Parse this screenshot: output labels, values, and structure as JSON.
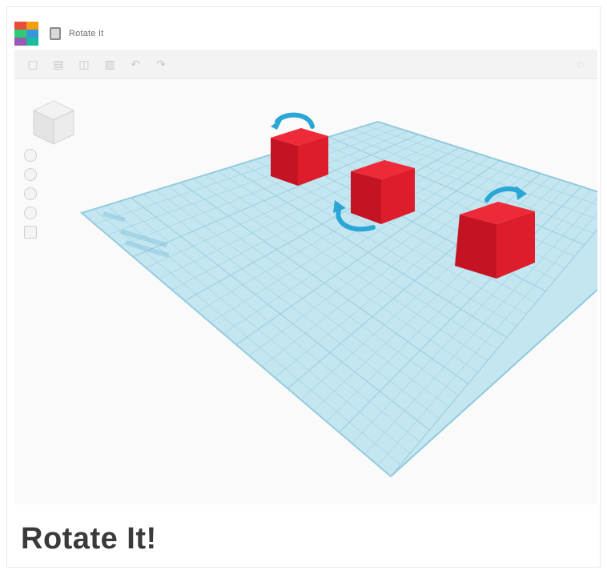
{
  "window": {
    "doc_title": "Rotate It"
  },
  "toolbar": {
    "buttons": [
      "copy-icon",
      "paste-icon",
      "duplicate-icon",
      "delete-icon",
      "undo-icon",
      "redo-icon"
    ],
    "right_button": "lightbulb-icon"
  },
  "viewport": {
    "workplane_color": "#bfe3ee",
    "grid_line_color": "#9fd0e2",
    "box_color": "#d81b2a",
    "arrow_color": "#2aa7d6",
    "boxes": [
      "red-box-left",
      "red-box-center",
      "red-box-right"
    ]
  },
  "caption": {
    "text": "Rotate It!"
  },
  "colors": {
    "logo": [
      "#e84c3d",
      "#f39c12",
      "#2ecc71",
      "#3498db",
      "#9b59b6",
      "#1abc9c"
    ]
  }
}
